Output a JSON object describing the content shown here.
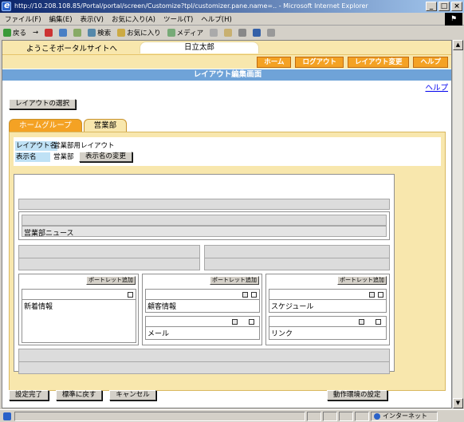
{
  "window": {
    "title": "http://10.208.108.85/Portal/portal/screen/Customize?tpl/customizer.pane.name=.. - Microsoft Internet Explorer",
    "menu": [
      "ファイル(F)",
      "編集(E)",
      "表示(V)",
      "お気に入り(A)",
      "ツール(T)",
      "ヘルプ(H)"
    ],
    "toolbar": [
      "戻る",
      "→",
      "",
      "",
      "",
      "検索",
      "お気に入り",
      "メディア",
      "",
      "",
      "",
      "",
      ""
    ]
  },
  "header": {
    "welcome": "ようこそポータルサイトへ",
    "user": "日立太郎",
    "nav": [
      "ホーム",
      "ログアウト",
      "レイアウト変更",
      "ヘルプ"
    ]
  },
  "page": {
    "title": "レイアウト編集画面",
    "help_link": "ヘルプ",
    "layout_select_button": "レイアウトの選択",
    "tabs": [
      {
        "label": "ホームグループ",
        "active": false
      },
      {
        "label": "営業部",
        "active": true
      }
    ],
    "layout_name_label": "レイアウト名",
    "layout_name": "営業部用レイアウト",
    "display_name_label": "表示名",
    "display_name": "営業部",
    "display_name_change_button": "表示名の変更"
  },
  "layout": {
    "top_portlet": "営業部ニュース",
    "columns": [
      {
        "add_button": "ポートレット追加",
        "portlets": [
          {
            "name": "新着情報",
            "controls": 1
          }
        ]
      },
      {
        "add_button": "ポートレット追加",
        "portlets": [
          {
            "name": "顧客情報",
            "controls": 2
          },
          {
            "name": "メール",
            "controls": 2
          }
        ]
      },
      {
        "add_button": "ポートレット追加",
        "portlets": [
          {
            "name": "スケジュール",
            "controls": 2
          },
          {
            "name": "リンク",
            "controls": 2
          }
        ]
      }
    ]
  },
  "footer_buttons": [
    "設定完了",
    "標準に戻す",
    "キャンセル"
  ],
  "env_button": "動作環境の設定",
  "status": {
    "zone": "インターネット"
  },
  "colors": {
    "tab_inactive": "#f4a224",
    "panel_bg": "#f8e7ad",
    "header_bar": "#6fa3d8",
    "label_bg": "#bfe1f5"
  }
}
